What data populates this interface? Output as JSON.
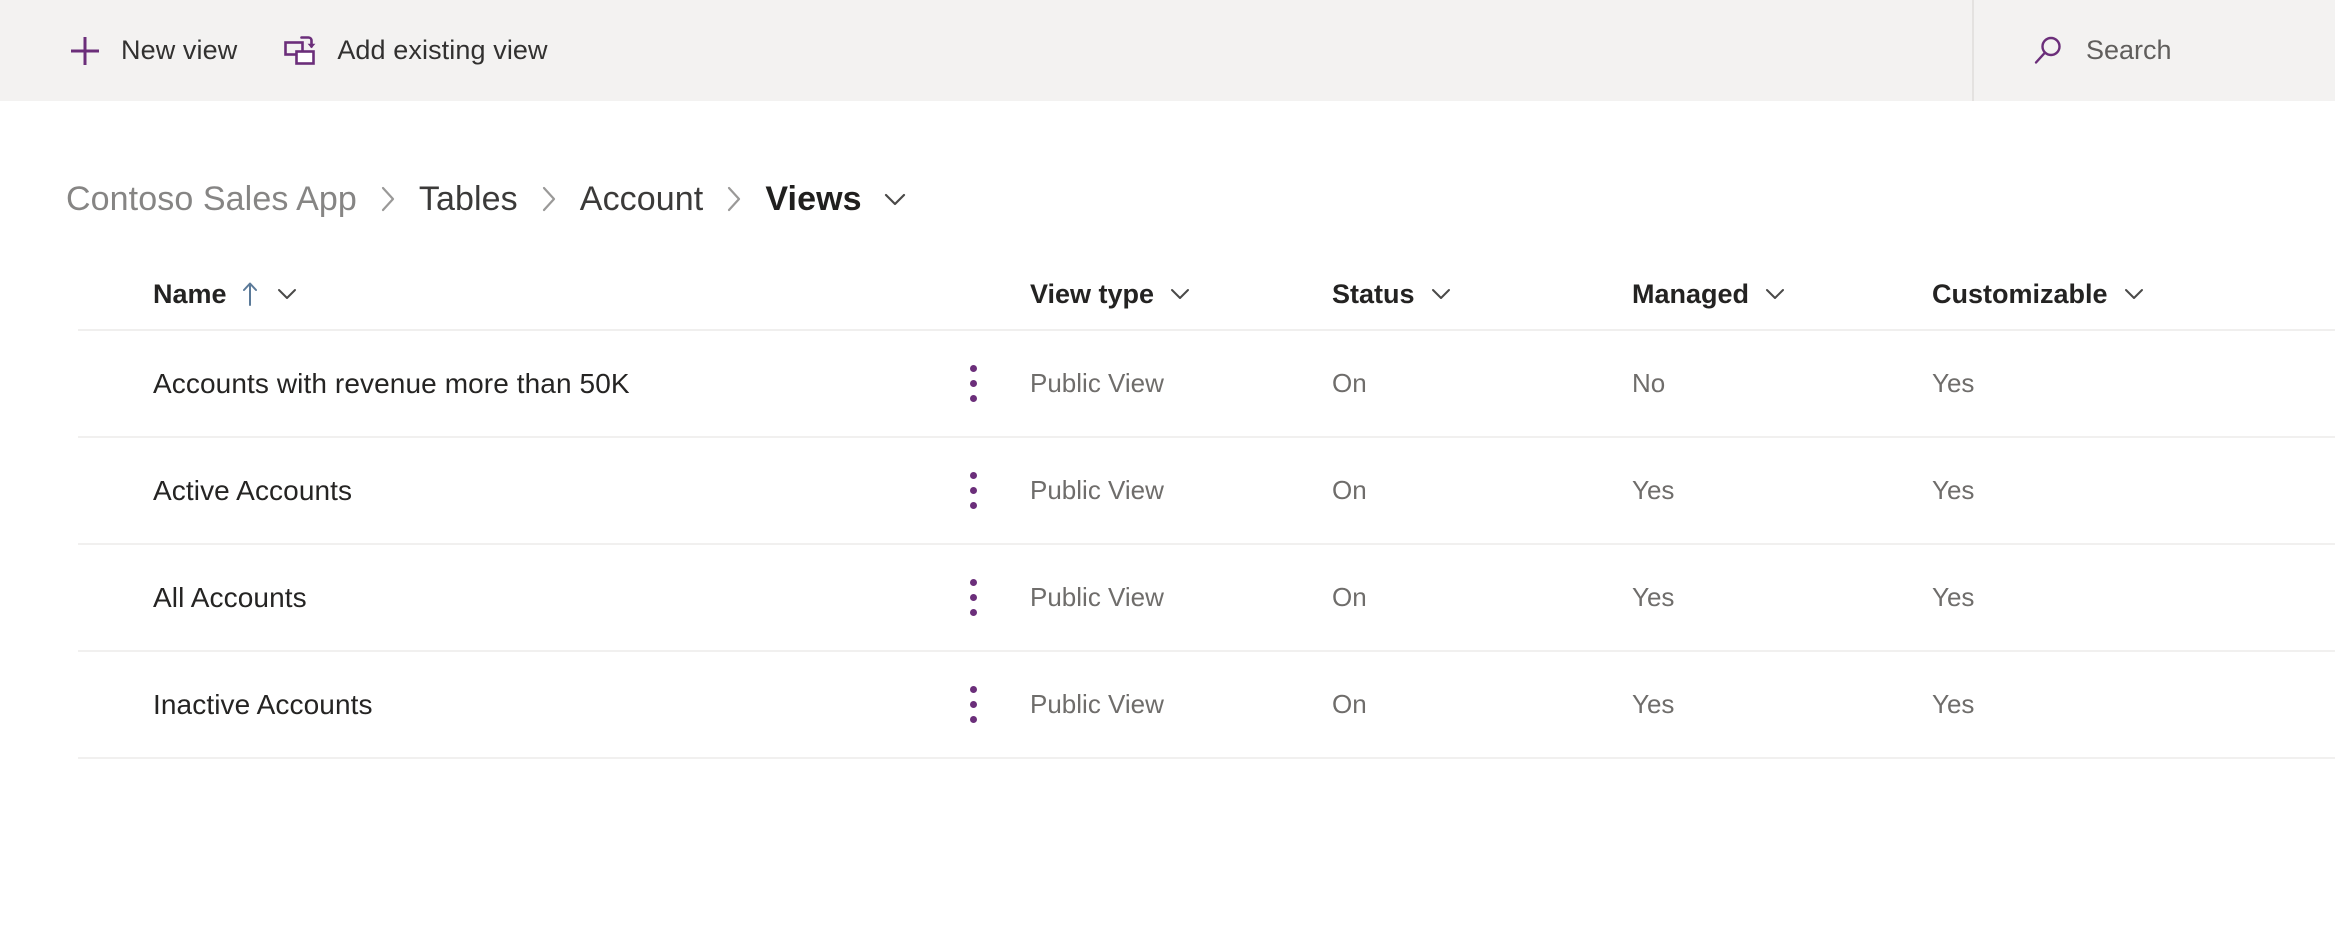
{
  "colors": {
    "accent_purple": "#6b2e7a",
    "command_bar_bg": "#f3f2f1",
    "content_bg": "#ffffff",
    "text_primary": "#252423",
    "text_secondary": "#6f6d6b",
    "divider": "#f1f0ef"
  },
  "command_bar": {
    "buttons": [
      {
        "id": "new-view",
        "label": "New view",
        "icon": "plus-icon"
      },
      {
        "id": "add-existing-view",
        "label": "Add existing view",
        "icon": "add-existing-view-icon"
      }
    ],
    "search": {
      "placeholder": "Search",
      "icon": "search-icon"
    }
  },
  "breadcrumb": {
    "items": [
      {
        "label": "Contoso Sales App",
        "style": "muted"
      },
      {
        "label": "Tables",
        "style": "normal"
      },
      {
        "label": "Account",
        "style": "normal"
      },
      {
        "label": "Views",
        "style": "current"
      }
    ],
    "separator": "›",
    "current_has_dropdown": true
  },
  "table": {
    "columns": [
      {
        "key": "name",
        "label": "Name",
        "sorted": true,
        "sort_direction": "ascending",
        "sort_glyph": "↑",
        "has_dropdown": true
      },
      {
        "key": "view_type",
        "label": "View type",
        "has_dropdown": true
      },
      {
        "key": "status",
        "label": "Status",
        "has_dropdown": true
      },
      {
        "key": "managed",
        "label": "Managed",
        "has_dropdown": true
      },
      {
        "key": "customizable",
        "label": "Customizable",
        "has_dropdown": true
      }
    ],
    "rows": [
      {
        "name": "Accounts with revenue more than 50K",
        "view_type": "Public View",
        "status": "On",
        "managed": "No",
        "customizable": "Yes"
      },
      {
        "name": "Active Accounts",
        "view_type": "Public View",
        "status": "On",
        "managed": "Yes",
        "customizable": "Yes"
      },
      {
        "name": "All Accounts",
        "view_type": "Public View",
        "status": "On",
        "managed": "Yes",
        "customizable": "Yes"
      },
      {
        "name": "Inactive Accounts",
        "view_type": "Public View",
        "status": "On",
        "managed": "Yes",
        "customizable": "Yes"
      }
    ],
    "row_menu_icon": "more-options-vertical-ellipsis-icon"
  }
}
